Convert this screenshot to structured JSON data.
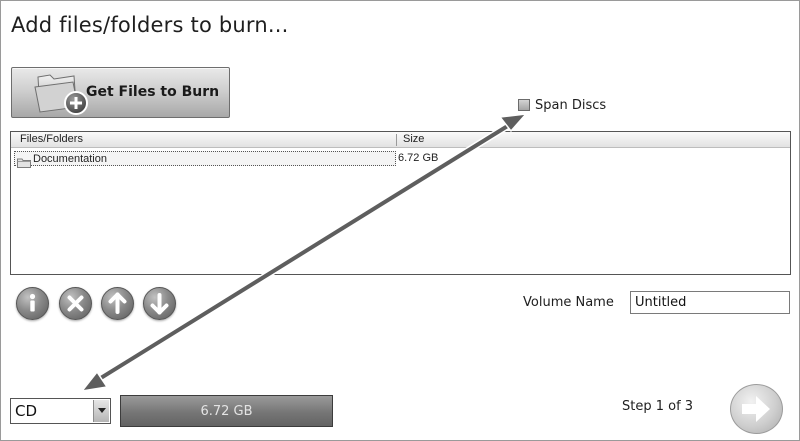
{
  "title": "Add files/folders to burn...",
  "toolbar": {
    "get_files_label": "Get Files to Burn",
    "get_files_icon": "folder-add-icon"
  },
  "span_discs": {
    "label": "Span Discs",
    "checked": false
  },
  "file_list": {
    "columns": [
      "Files/Folders",
      "Size"
    ],
    "rows": [
      {
        "name": "Documentation",
        "size": "6.72 GB",
        "icon": "folder-icon"
      }
    ]
  },
  "actions": [
    {
      "name": "info",
      "icon": "info-icon"
    },
    {
      "name": "remove",
      "icon": "remove-icon"
    },
    {
      "name": "move-up",
      "icon": "arrow-up-icon"
    },
    {
      "name": "move-down",
      "icon": "arrow-down-icon"
    }
  ],
  "volume": {
    "label": "Volume Name",
    "value": "Untitled"
  },
  "disc_type": {
    "selected": "CD"
  },
  "capacity": {
    "text": "6.72 GB"
  },
  "step": {
    "text": "Step 1 of 3"
  },
  "navigation": {
    "next_icon": "arrow-right-icon"
  },
  "colors": {
    "annotation_arrow": "#5e5e5e",
    "capacity_bar": "#767676"
  }
}
